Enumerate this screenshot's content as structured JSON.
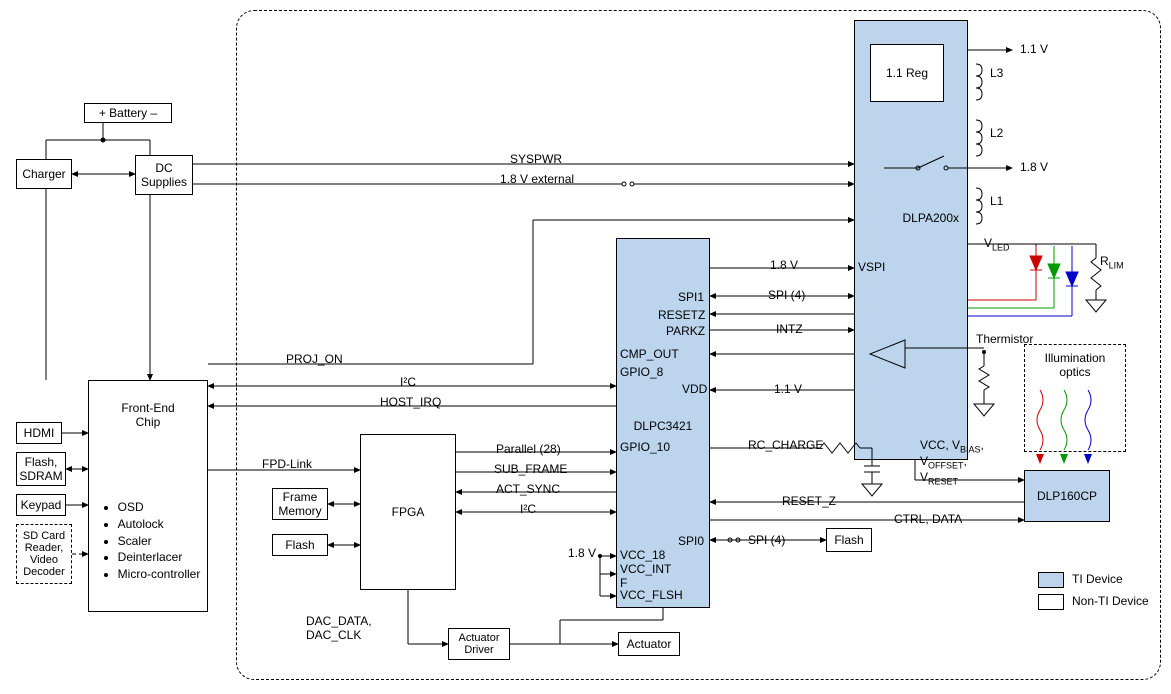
{
  "blocks": {
    "battery": "+ Battery  –",
    "charger": "Charger",
    "dc_supplies": "DC\nSupplies",
    "hdmi": "HDMI",
    "flash_sdram": "Flash,\nSDRAM",
    "keypad": "Keypad",
    "sdcard": "SD Card\nReader,\nVideo\nDecoder",
    "front_end": "Front-End\nChip",
    "front_end_list": [
      "OSD",
      "Autolock",
      "Scaler",
      "Deinterlacer",
      "Micro-controller"
    ],
    "frame_memory": "Frame\nMemory",
    "fpga_flash": "Flash",
    "fpga": "FPGA",
    "actuator_driver": "Actuator\nDriver",
    "actuator": "Actuator",
    "dlpc": "DLPC3421",
    "reg11": "1.1 Reg",
    "dlpa": "DLPA200x",
    "spi_flash": "Flash",
    "dlp160": "DLP160CP",
    "illum": "Illumination\noptics",
    "legend_ti": "TI Device",
    "legend_nonti": "Non-TI Device"
  },
  "signals": {
    "syspwr": "SYSPWR",
    "ext18": "1.8 V external",
    "proj_on": "PROJ_ON",
    "i2c": "I²C",
    "host_irq": "HOST_IRQ",
    "fpd_link": "FPD-Link",
    "parallel28": "Parallel (28)",
    "sub_frame": "SUB_FRAME",
    "act_sync": "ACT_SYNC",
    "i2c2": "I²C",
    "sig18v": "1.8 V",
    "dac": "DAC_DATA,\nDAC_CLK",
    "vspi18": "1.8 V",
    "vspi": "VSPI",
    "spi1": "SPI1",
    "spi4": "SPI (4)",
    "resetz": "RESETZ",
    "parkz": "PARKZ",
    "intz": "INTZ",
    "cmp_out": "CMP_OUT",
    "gpio8": "GPIO_8",
    "vdd": "VDD",
    "vdd11": "1.1 V",
    "gpio10": "GPIO_10",
    "rc_charge": "RC_CHARGE",
    "spi0": "SPI0",
    "spi04": "SPI (4)",
    "vcc18": "VCC_18",
    "vcc_int": "VCC_INT\nF",
    "vcc_flsh": "VCC_FLSH",
    "reset_z": "RESET_Z",
    "ctrl_data": "CTRL, DATA",
    "vcc_bias": "VCC, V",
    "bias": "BIAS",
    "voffset": "V",
    "offset": "OFFSET",
    "vreset": "V",
    "reset": "RESET",
    "L1": "L1",
    "L2": "L2",
    "L3": "L3",
    "out11": "1.1 V",
    "out18": "1.8 V",
    "vled": "V",
    "led": "LED",
    "rlim": "R",
    "lim": "LIM",
    "thermistor": "Thermistor"
  }
}
